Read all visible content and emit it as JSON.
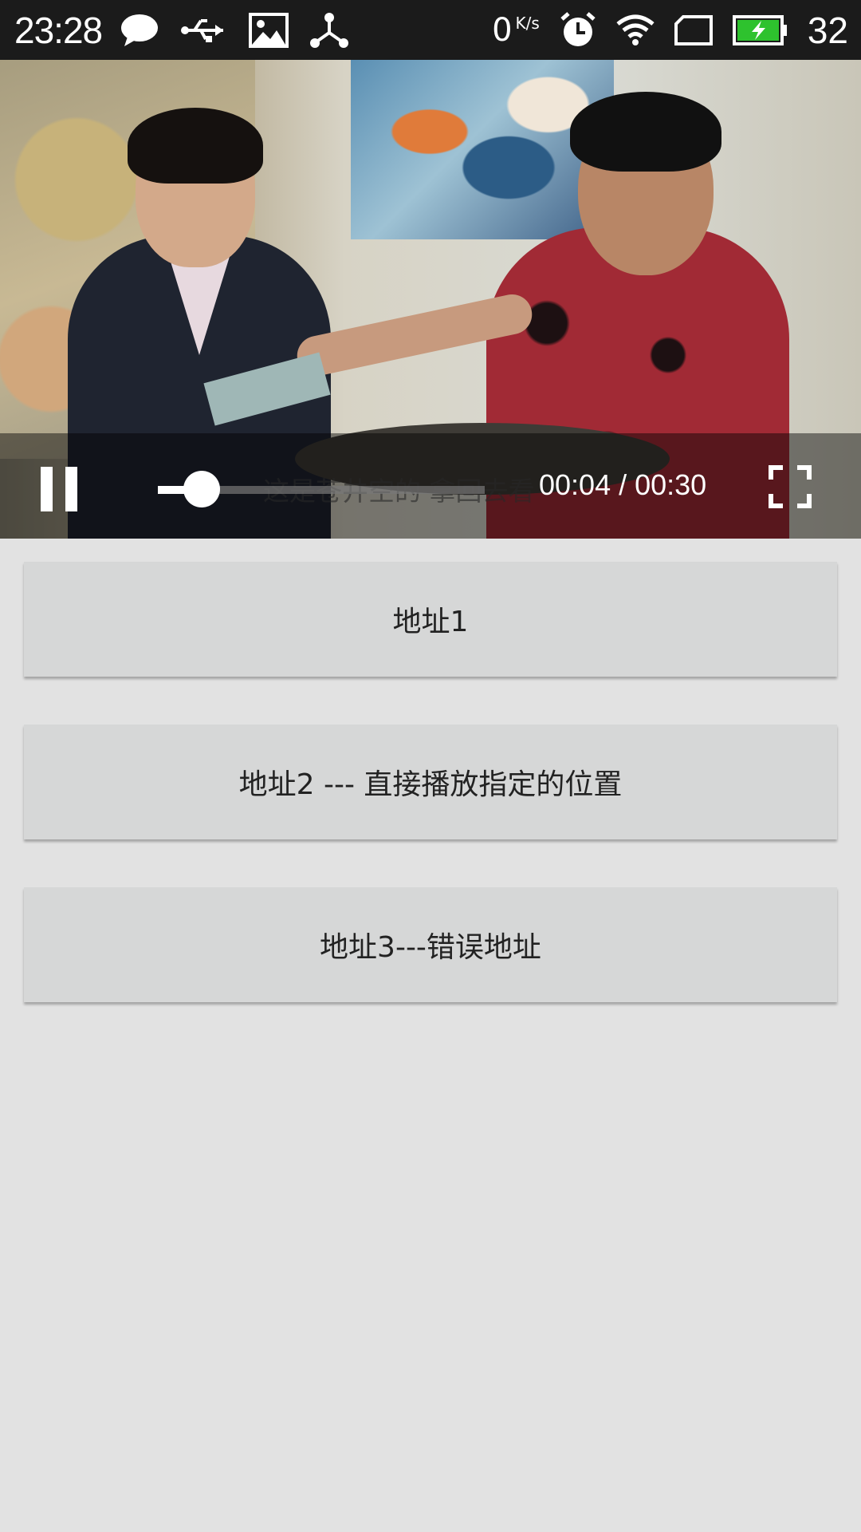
{
  "status_bar": {
    "time": "23:28",
    "left_icons": [
      "chat-icon",
      "usb-icon",
      "image-icon",
      "share-icon"
    ],
    "net_speed_value": "0",
    "net_speed_unit": "K/s",
    "right_icons": [
      "alarm-icon",
      "wifi-icon",
      "no-sim-icon",
      "battery-charging-icon"
    ],
    "battery": "32",
    "battery_color": "#2ec22e"
  },
  "player": {
    "subtitle": "这是苍井空的 拿回去看",
    "time_display": "00:04 / 00:30",
    "progress_fraction": 0.133,
    "state": "playing"
  },
  "buttons": {
    "url1": "地址1",
    "url2": "地址2 --- 直接播放指定的位置",
    "url3": "地址3---错误地址"
  }
}
